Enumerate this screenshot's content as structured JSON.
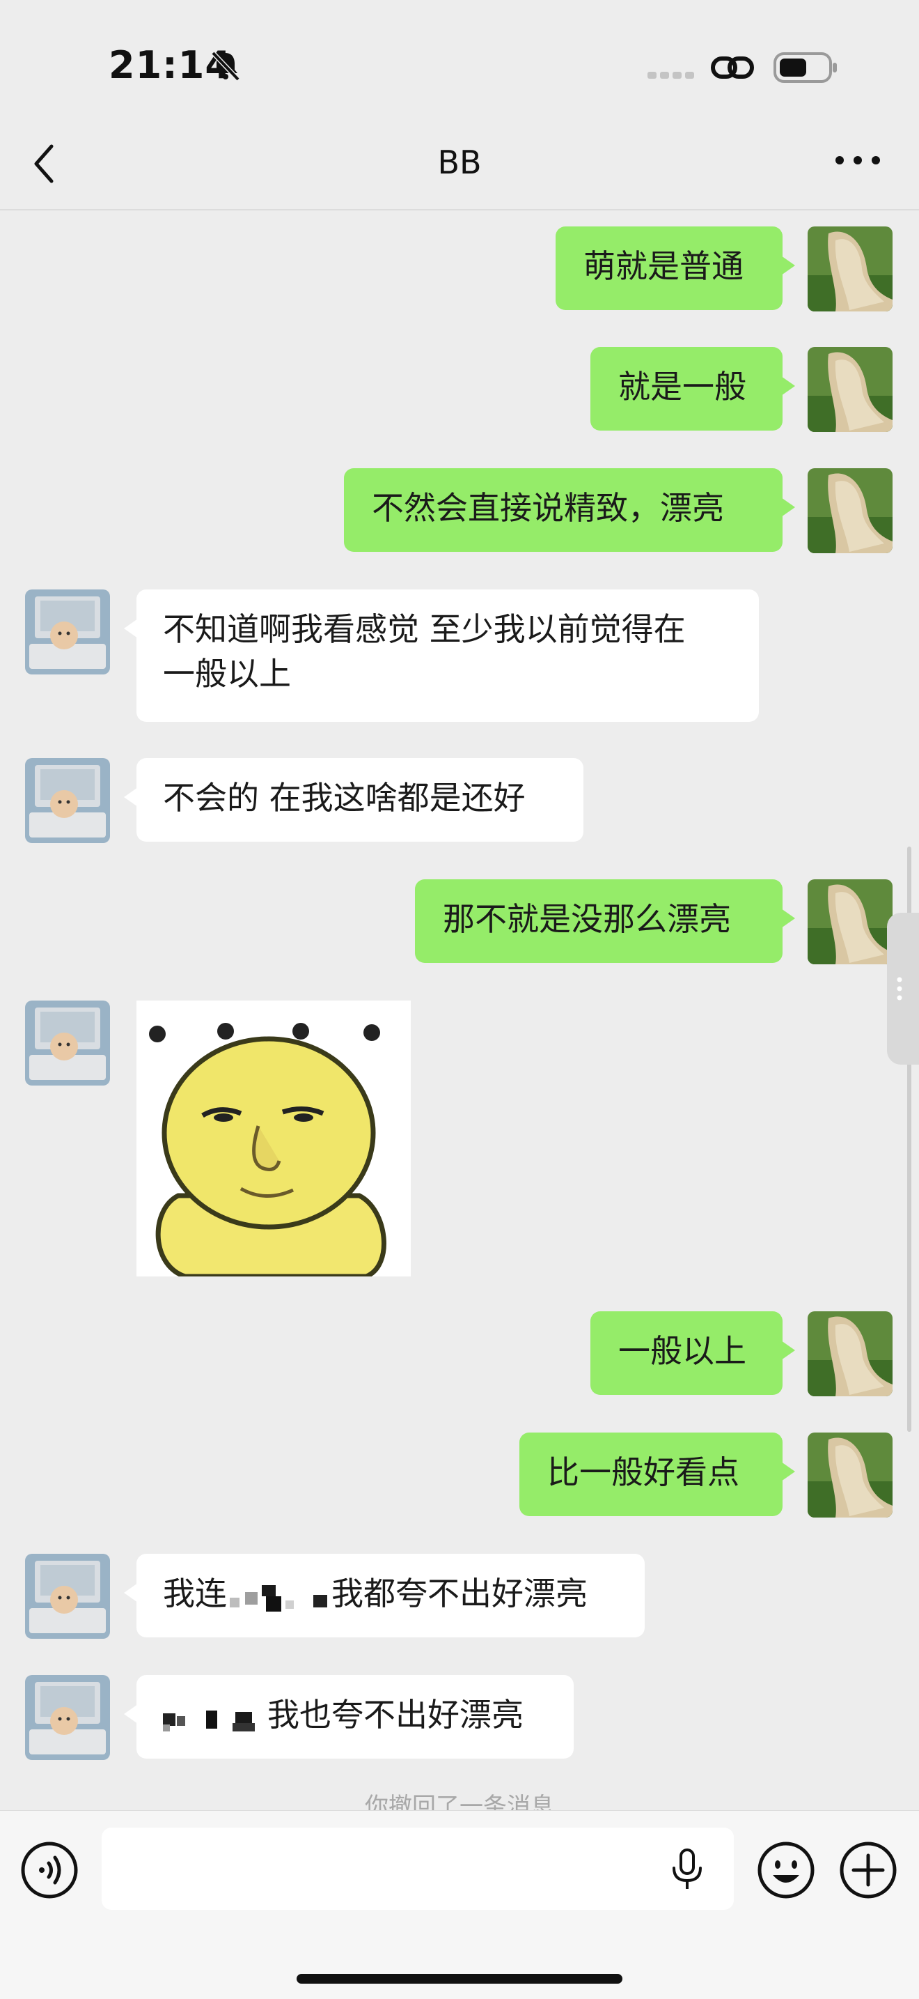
{
  "status_bar": {
    "time": "21:14"
  },
  "chat": {
    "title": "BB"
  },
  "messages": [
    {
      "sender": "me",
      "text": "萌就是普通"
    },
    {
      "sender": "me",
      "text": "就是一般"
    },
    {
      "sender": "me",
      "text": "不然会直接说精致，漂亮"
    },
    {
      "sender": "other",
      "lines": [
        "不知道啊我看感觉 至少我以前觉得在",
        "一般以上"
      ]
    },
    {
      "sender": "other",
      "text": "不会的 在我这啥都是还好"
    },
    {
      "sender": "me",
      "text": "那不就是没那么漂亮"
    },
    {
      "sender": "other",
      "type": "sticker",
      "sticker": "yellow-chick-face-sticker"
    },
    {
      "sender": "me",
      "text": "一般以上"
    },
    {
      "sender": "me",
      "text": "比一般好看点"
    },
    {
      "sender": "other",
      "prefix": "我连",
      "text": "我都夸不出好漂亮"
    },
    {
      "sender": "other",
      "text": "我也夸不出好漂亮"
    }
  ],
  "system_notice": "你撤回了一条消息",
  "input_bar": {
    "left_icon": "voice-mode-icon",
    "mic_icon": "microphone-icon",
    "emoji_icon": "emoji-icon",
    "plus_icon": "plus-icon"
  },
  "colors": {
    "background": "#ededed",
    "my_bubble": "#95ec69",
    "their_bubble": "#ffffff",
    "system_text": "#a8a8a8"
  }
}
